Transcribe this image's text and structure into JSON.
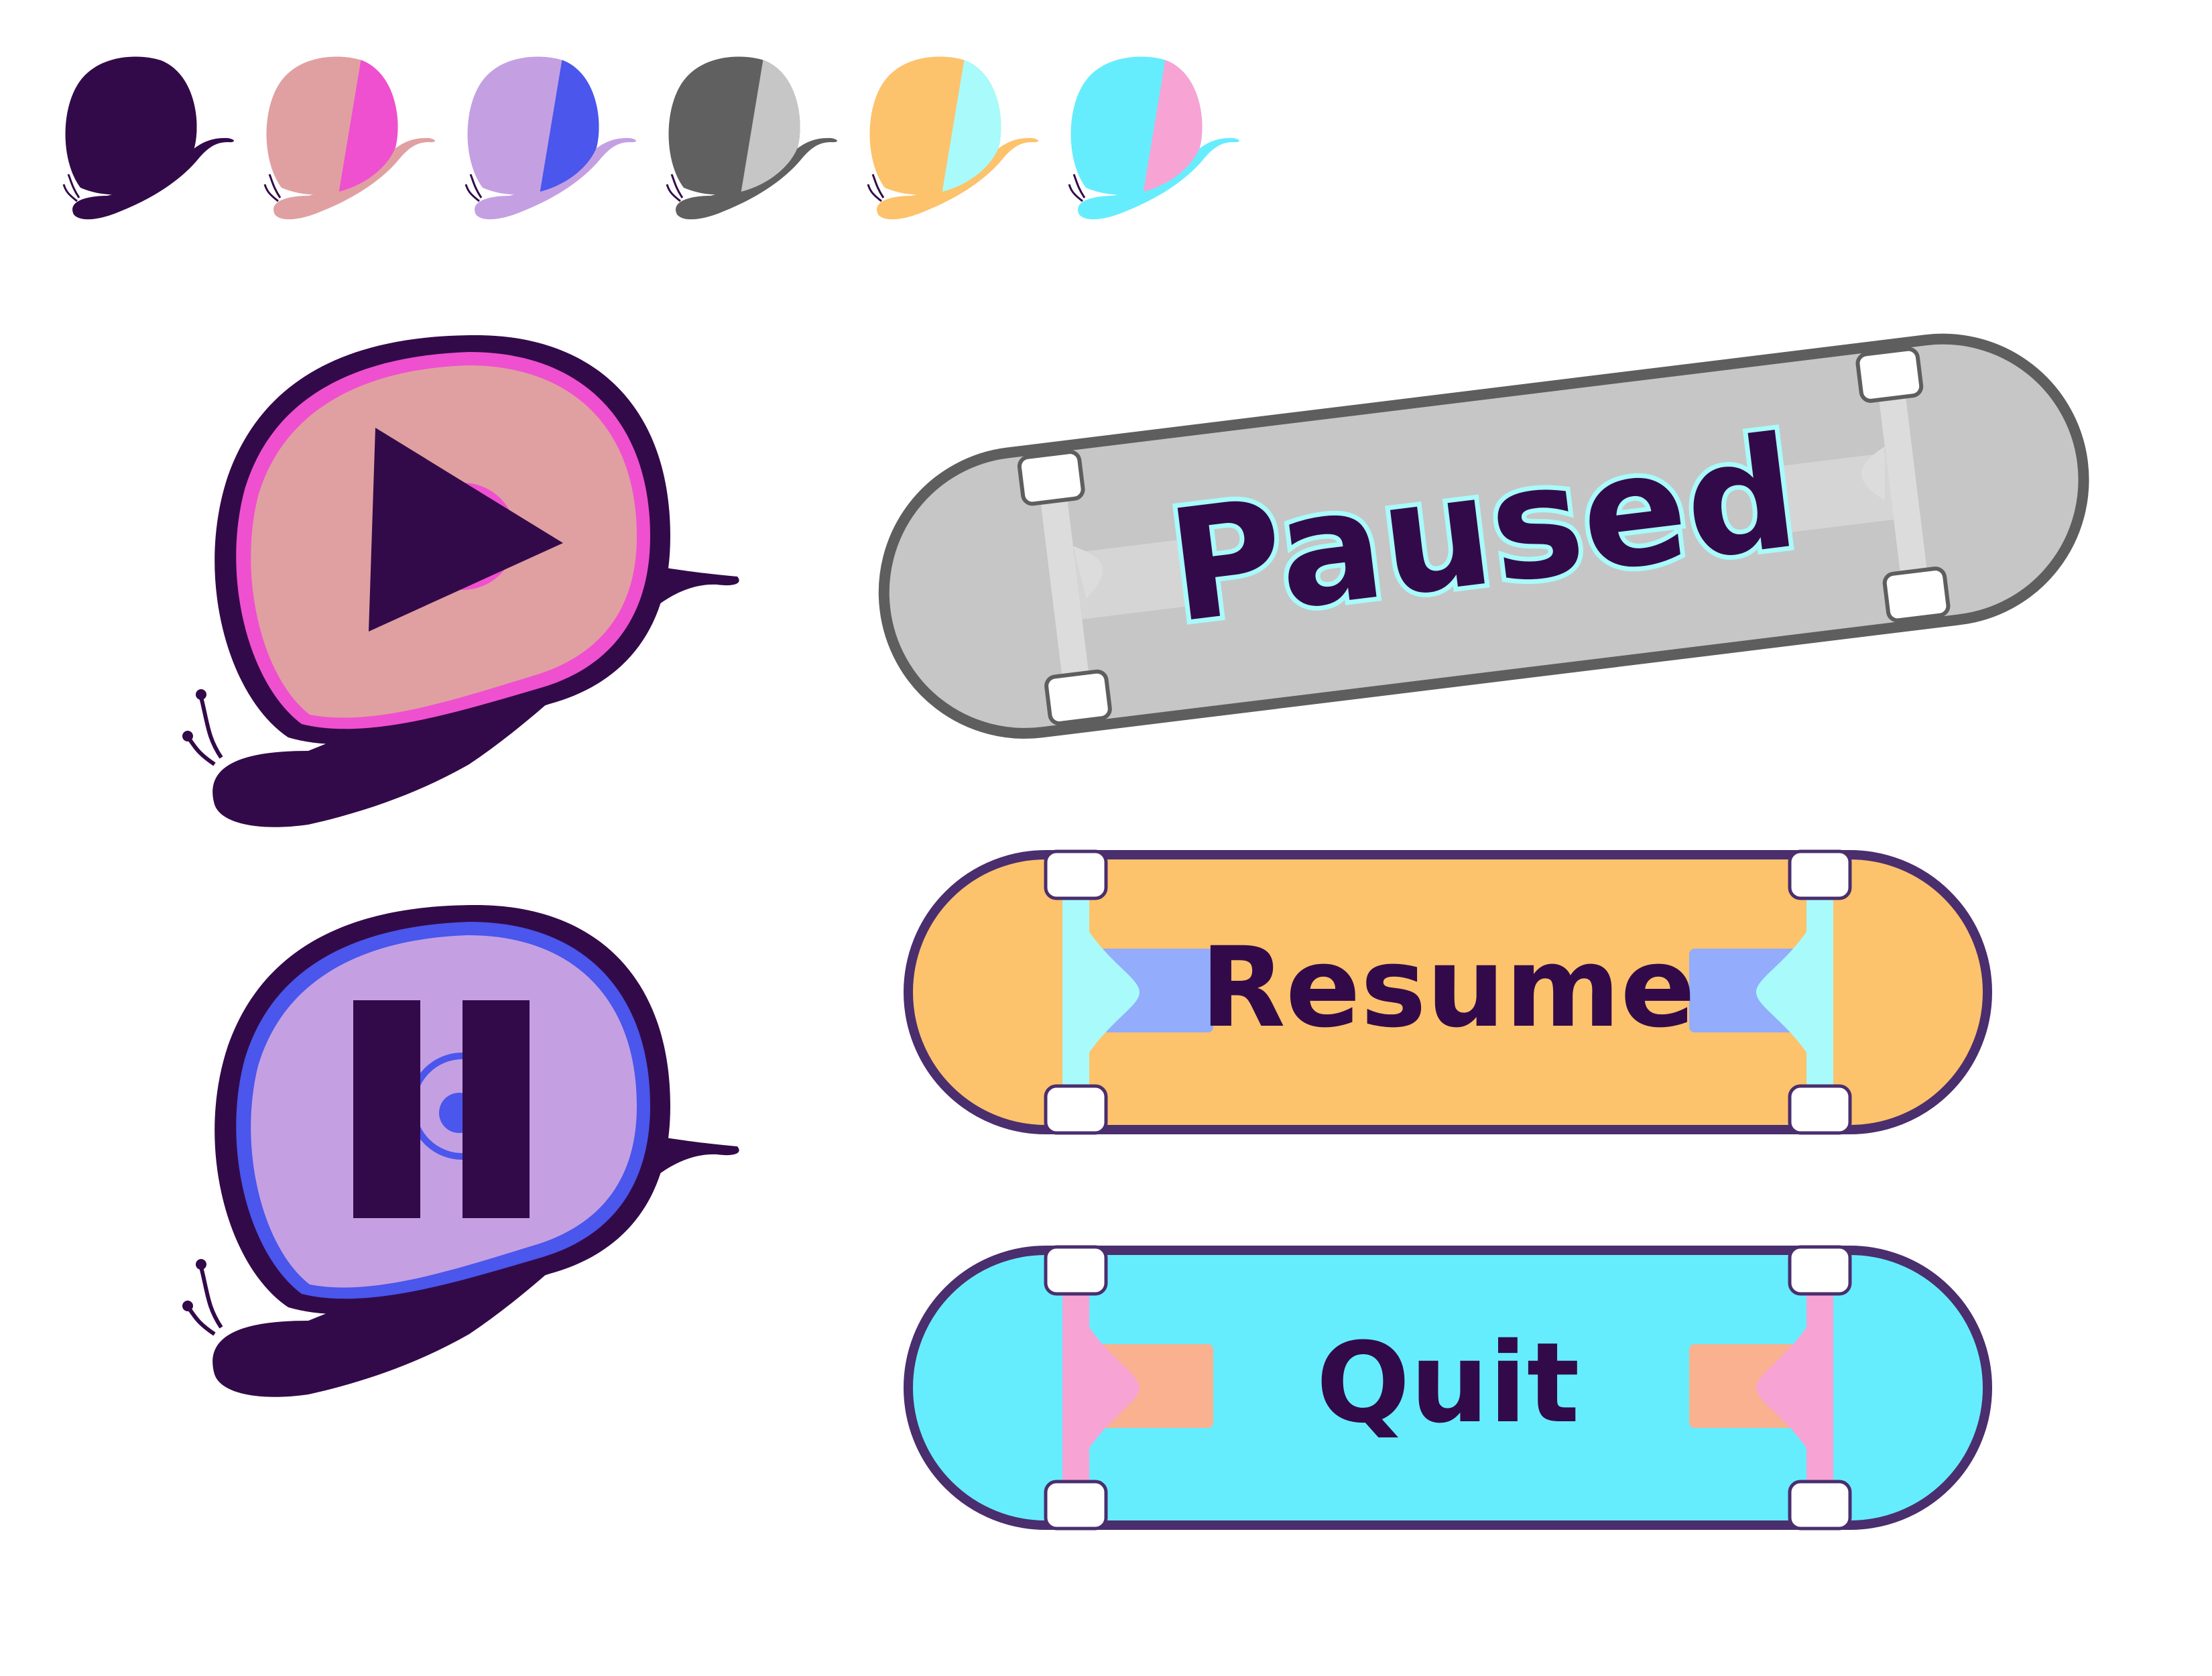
{
  "colors": {
    "ink": "#330a49",
    "snail_palettes": [
      {
        "name": "dark",
        "shell": "#330a49",
        "stripe": "#330a49",
        "body": "#330a49"
      },
      {
        "name": "rose",
        "shell": "#e0a0a2",
        "stripe": "#ef50cf",
        "body": "#e0a0a2"
      },
      {
        "name": "lavender",
        "shell": "#c4a0e2",
        "stripe": "#4a56ec",
        "body": "#c4a0e2"
      },
      {
        "name": "grey",
        "shell": "#606060",
        "stripe": "#c6c6c6",
        "body": "#606060"
      },
      {
        "name": "orange",
        "shell": "#fdc26c",
        "stripe": "#a8fbfa",
        "body": "#fdc26c"
      },
      {
        "name": "cyan",
        "shell": "#66edfd",
        "stripe": "#f7a3d4",
        "body": "#66edfd"
      }
    ],
    "paused_board": {
      "deck": "#c6c6c6",
      "outline": "#5e5e5e",
      "truck": "#dcdcdc"
    },
    "resume_board": {
      "deck": "#fdc26c",
      "outline": "#4a2e6e",
      "truck": "#a8fbfa",
      "pad": "#93acfb"
    },
    "quit_board": {
      "deck": "#66edfd",
      "outline": "#4a2e6e",
      "truck": "#f7a3d4",
      "pad": "#f9b190"
    }
  },
  "icons": {
    "play_button": "play-icon",
    "pause_button": "pause-icon"
  },
  "labels": {
    "title": "Paused",
    "resume": "Resume",
    "quit": "Quit"
  }
}
